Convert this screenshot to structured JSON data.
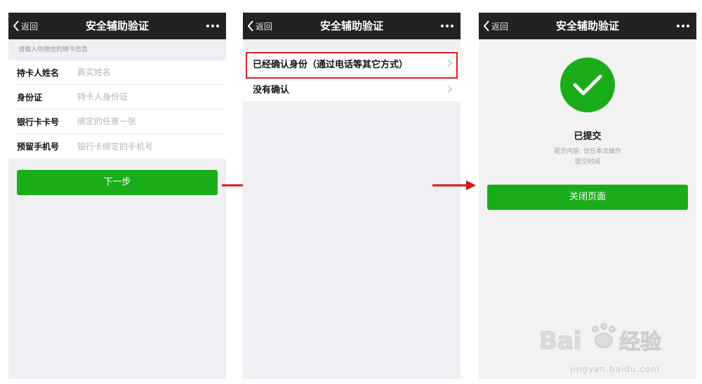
{
  "colors": {
    "accent_green": "#1aad19",
    "navbar": "#222222",
    "highlight_red": "#e02020",
    "arrow_red": "#d9141b"
  },
  "nav": {
    "back_label": "返回",
    "title": "安全辅助验证"
  },
  "step1": {
    "hint": "请输入你微信的绑卡信息",
    "fields": [
      {
        "label": "持卡人姓名",
        "placeholder": "真实姓名"
      },
      {
        "label": "身份证",
        "placeholder": "持卡人身份证"
      },
      {
        "label": "银行卡卡号",
        "placeholder": "绑定的任意一张"
      },
      {
        "label": "预留手机号",
        "placeholder": "银行卡绑定的手机号"
      }
    ],
    "next_button": "下一步"
  },
  "step2": {
    "options": [
      {
        "label": "已经确认身份（通过电话等其它方式）"
      },
      {
        "label": "没有确认"
      }
    ]
  },
  "step3": {
    "status_title": "已提交",
    "detail_line1": "提交内容: 信任本次操作",
    "detail_line2": "提交时间",
    "close_button": "关闭页面"
  },
  "watermark": {
    "url": "jingyan.baidu.com"
  }
}
